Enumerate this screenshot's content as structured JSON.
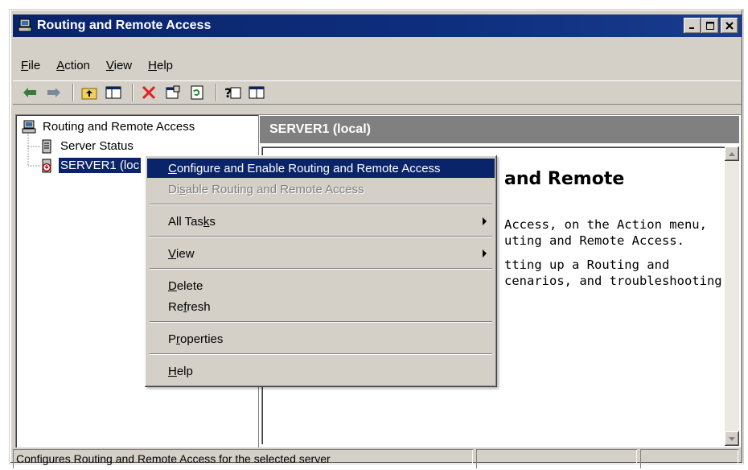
{
  "window": {
    "title": "Routing and Remote Access",
    "controls": {
      "minimize": "_",
      "maximize": "□",
      "close": "×"
    }
  },
  "menubar": [
    {
      "label": "File",
      "key": "F",
      "rest": "ile"
    },
    {
      "label": "Action",
      "key": "A",
      "rest": "ction"
    },
    {
      "label": "View",
      "key": "V",
      "rest": "iew"
    },
    {
      "label": "Help",
      "key": "H",
      "rest": "elp"
    }
  ],
  "toolbar": {
    "icons": [
      "back-arrow-icon",
      "forward-arrow-icon",
      "up-folder-icon",
      "show-hide-tree-icon",
      "delete-icon",
      "properties-icon",
      "refresh-icon",
      "help-icon",
      "console-icon"
    ]
  },
  "tree": {
    "root": "Routing and Remote Access",
    "items": [
      {
        "label": "Server Status"
      },
      {
        "label": "SERVER1 (local)",
        "visible_text": "SERVER1 (loc"
      }
    ]
  },
  "right_pane": {
    "header": "SERVER1 (local)",
    "heading": "and Remote",
    "lines": [
      "Access, on the Action menu,",
      "uting and Remote Access.",
      "tting up a Routing and",
      "cenarios, and troubleshooting,"
    ]
  },
  "context_menu": {
    "items": [
      {
        "pre": "",
        "key": "C",
        "post": "onfigure and Enable Routing and Remote Access",
        "highlighted": true
      },
      {
        "pre": "Di",
        "key": "s",
        "post": "able Routing and Remote Access",
        "disabled": true
      },
      {
        "pre": "All Tas",
        "key": "k",
        "post": "s",
        "submenu": true
      },
      {
        "pre": "",
        "key": "V",
        "post": "iew",
        "submenu": true
      },
      {
        "pre": "",
        "key": "D",
        "post": "elete"
      },
      {
        "pre": "Re",
        "key": "f",
        "post": "resh"
      },
      {
        "pre": "P",
        "key": "r",
        "post": "operties"
      },
      {
        "pre": "",
        "key": "H",
        "post": "elp"
      }
    ]
  },
  "status": {
    "text": "Configures Routing and Remote Access for the selected server"
  },
  "colors": {
    "title_bar": "#0a246a",
    "selection": "#0a246a",
    "face": "#d4d0c8",
    "pane_header": "#808080"
  }
}
